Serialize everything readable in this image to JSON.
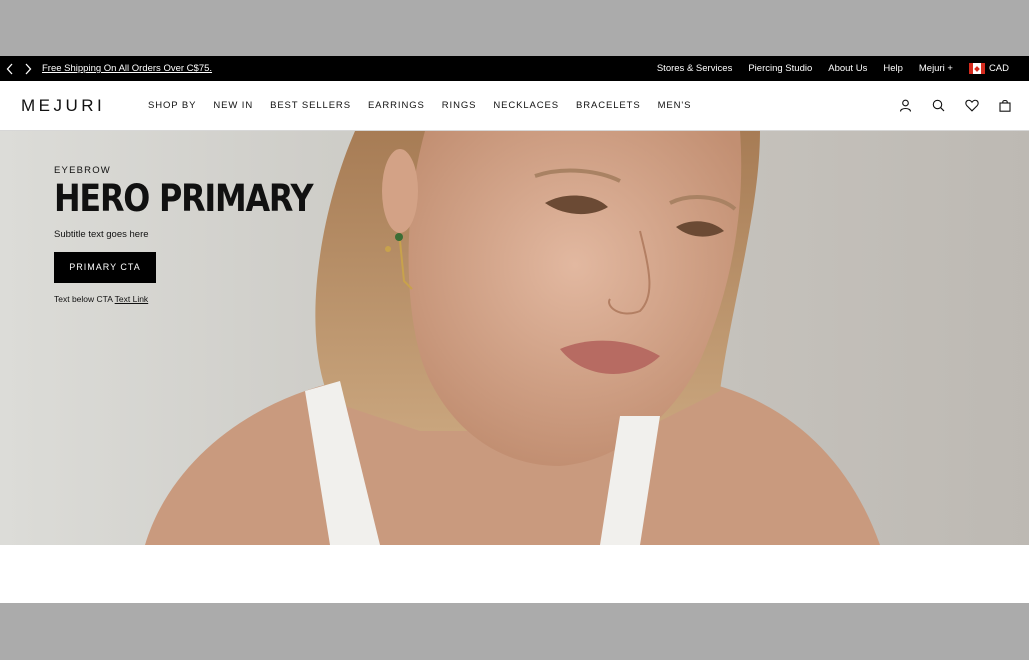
{
  "announcement": {
    "promo": "Free Shipping On All Orders Over C$75.",
    "links": [
      "Stores & Services",
      "Piercing Studio",
      "About Us",
      "Help",
      "Mejuri +"
    ],
    "currency": "CAD"
  },
  "nav": {
    "logo": "MEJURI",
    "menu": [
      "SHOP BY",
      "NEW IN",
      "BEST SELLERS",
      "EARRINGS",
      "RINGS",
      "NECKLACES",
      "BRACELETS",
      "MEN'S"
    ],
    "icons": [
      "account-icon",
      "search-icon",
      "heart-icon",
      "bag-icon"
    ]
  },
  "hero": {
    "eyebrow": "EYEBROW",
    "title": "HERO PRIMARY",
    "subtitle": "Subtitle text goes here",
    "cta": "PRIMARY CTA",
    "below_text": "Text below CTA",
    "text_link": "Text Link"
  }
}
